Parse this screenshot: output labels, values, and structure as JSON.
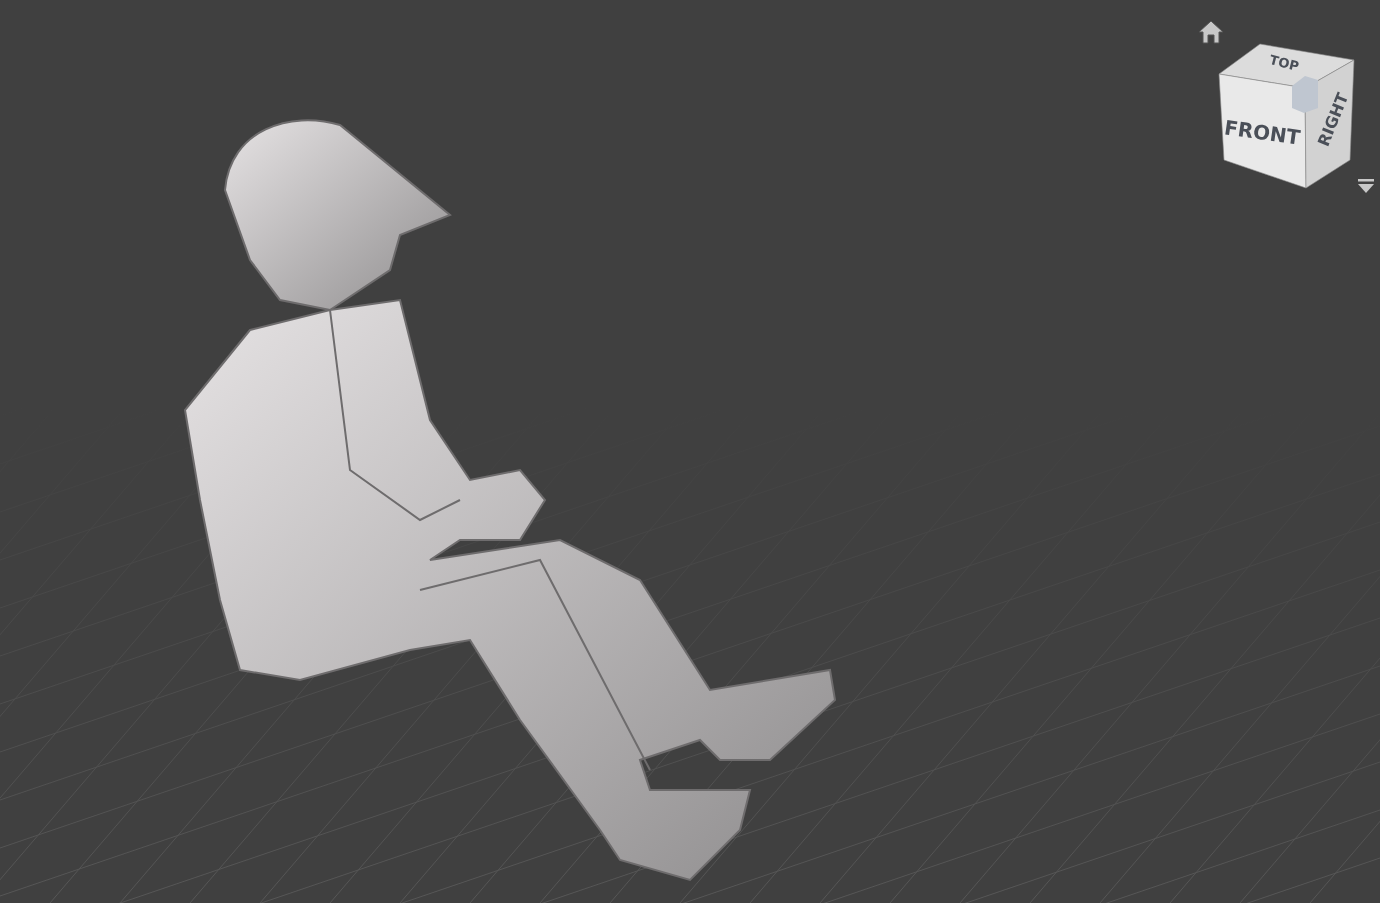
{
  "viewcube": {
    "faces": [
      {
        "label": "TOP",
        "kind": "top"
      },
      {
        "label": "FRONT",
        "kind": "front"
      },
      {
        "label": "RIGHT",
        "kind": "right"
      }
    ]
  }
}
